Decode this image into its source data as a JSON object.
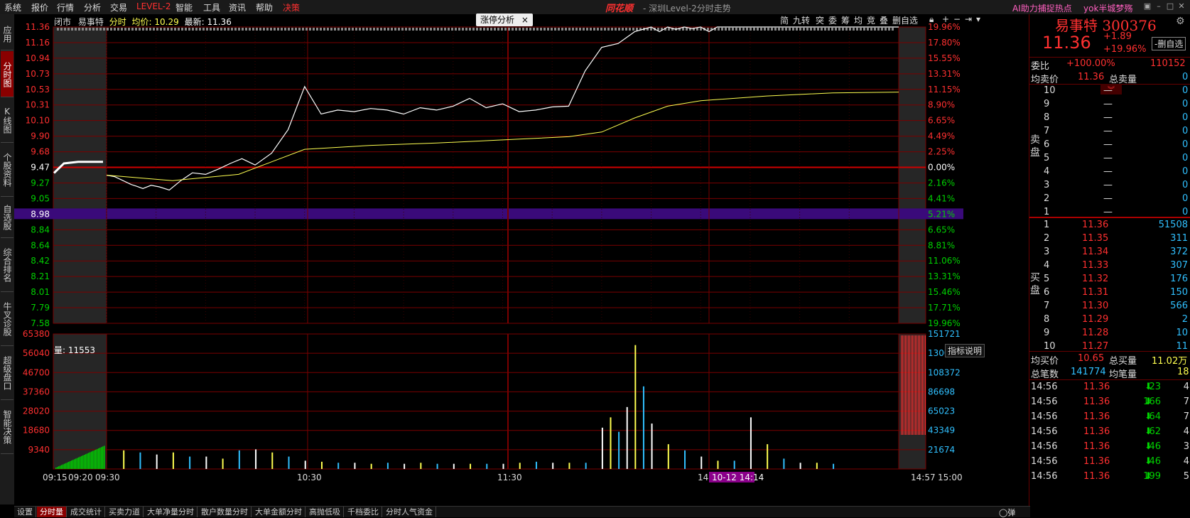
{
  "menu": {
    "items": [
      "系统",
      "报价",
      "行情",
      "分析",
      "交易",
      "LEVEL-2",
      "智能",
      "工具",
      "资讯",
      "帮助",
      "决策"
    ]
  },
  "window": {
    "brand": "同花顺",
    "title": "- 深圳Level-2分时走势",
    "ai_link": "AI助力捕捉热点",
    "user": "yok半城梦殇"
  },
  "sidebar": {
    "tabs": [
      "应用",
      "分时图",
      "K线图",
      "个股资料",
      "自选股",
      "综合排名",
      "牛叉诊股",
      "超级盘口",
      "智能决策"
    ]
  },
  "info": {
    "status": "闭市",
    "name": "易事特",
    "mode": "分时",
    "avg_label": "均价:",
    "avg": "10.29",
    "last_label": "最新:",
    "last": "11.36"
  },
  "limit_tag": {
    "label": "涨停分析",
    "close": "×"
  },
  "toolbar": {
    "items": [
      "简",
      "九转",
      "突",
      "委",
      "筹",
      "均",
      "竞",
      "叠",
      "删自选"
    ]
  },
  "chart_data": [
    {
      "type": "line",
      "title": "",
      "x_ticks": [
        "09:15",
        "09:20",
        "09:30",
        "10:30",
        "11:30",
        "14:00",
        "14:57",
        "15:00"
      ],
      "cursor_label": "10-12 14:14",
      "price_ticks": [
        "11.36",
        "11.16",
        "10.94",
        "10.73",
        "10.53",
        "10.31",
        "10.10",
        "9.90",
        "9.68",
        "9.47",
        "9.27",
        "9.05",
        "8.98",
        "8.84",
        "8.64",
        "8.42",
        "8.21",
        "8.01",
        "7.79",
        "7.58"
      ],
      "pct_ticks": [
        "19.96%",
        "17.80%",
        "15.55%",
        "13.31%",
        "11.15%",
        "8.90%",
        "6.65%",
        "4.49%",
        "2.25%",
        "0.00%",
        "2.16%",
        "4.41%",
        "5.21%",
        "6.65%",
        "8.81%",
        "11.06%",
        "13.31%",
        "15.46%",
        "17.71%",
        "19.96%"
      ],
      "ylim": [
        7.58,
        11.36
      ],
      "prev_close": 9.47,
      "highlight_price": "8.98",
      "highlight_pct": "5.21%",
      "series": [
        {
          "name": "",
          "x": [
            0,
            5,
            10,
            15,
            18,
            22,
            27,
            32,
            38,
            45,
            52,
            60,
            68,
            75,
            82,
            90,
            100,
            110,
            120,
            130,
            140,
            150,
            160,
            170,
            180,
            190,
            200,
            210,
            220,
            230,
            240,
            250,
            260,
            270,
            280,
            290,
            300,
            310,
            320,
            330,
            335,
            340,
            345,
            350,
            355,
            360,
            365,
            370,
            375,
            380,
            385,
            390,
            395,
            400,
            410,
            420,
            430,
            440,
            450,
            460,
            470,
            480
          ],
          "y": [
            9.47,
            9.45,
            9.4,
            9.35,
            9.33,
            9.3,
            9.34,
            9.32,
            9.28,
            9.4,
            9.5,
            9.48,
            9.55,
            9.62,
            9.68,
            9.6,
            9.75,
            10.05,
            10.6,
            10.25,
            10.3,
            10.28,
            10.32,
            10.3,
            10.25,
            10.33,
            10.3,
            10.35,
            10.45,
            10.33,
            10.38,
            10.28,
            10.3,
            10.34,
            10.35,
            10.8,
            11.1,
            11.15,
            11.3,
            11.36,
            11.3,
            11.36,
            11.33,
            11.36,
            11.34,
            11.36,
            11.3,
            11.36,
            11.36,
            11.36,
            11.36,
            11.36,
            11.36,
            11.36,
            11.36,
            11.36,
            11.36,
            11.36,
            11.36,
            11.36,
            11.36,
            11.36
          ]
        },
        {
          "name": "",
          "x": [
            0,
            40,
            80,
            120,
            160,
            200,
            240,
            280,
            300,
            320,
            340,
            360,
            400,
            440,
            480
          ],
          "y": [
            9.47,
            9.4,
            9.48,
            9.8,
            9.85,
            9.88,
            9.92,
            9.96,
            10.02,
            10.2,
            10.35,
            10.42,
            10.48,
            10.52,
            10.53
          ]
        }
      ]
    },
    {
      "type": "bar",
      "title": "",
      "label": "量: 11553",
      "indicator_button": "指标说明",
      "left_ticks": [
        "65380",
        "56040",
        "46700",
        "37360",
        "28020",
        "18680",
        "9340"
      ],
      "right_ticks": [
        "151721",
        "130047",
        "108372",
        "86698",
        "65023",
        "43349",
        "21674"
      ],
      "ylim": [
        0,
        65380
      ],
      "x": [
        10,
        20,
        30,
        40,
        50,
        60,
        70,
        80,
        90,
        100,
        110,
        120,
        130,
        140,
        150,
        160,
        170,
        180,
        190,
        200,
        210,
        220,
        230,
        240,
        250,
        260,
        270,
        280,
        290,
        300,
        305,
        310,
        315,
        320,
        325,
        330,
        340,
        350,
        360,
        370,
        380,
        390,
        400,
        410,
        420,
        430,
        440
      ],
      "values": [
        9000,
        8000,
        7000,
        8000,
        6000,
        6000,
        5000,
        9000,
        9500,
        8000,
        6000,
        4000,
        3500,
        3000,
        3000,
        2500,
        3000,
        2500,
        3000,
        2500,
        2500,
        2500,
        2500,
        2500,
        3000,
        3500,
        3000,
        3000,
        3000,
        20000,
        25000,
        18000,
        30000,
        60000,
        40000,
        22000,
        12000,
        9000,
        6000,
        4000,
        4000,
        25000,
        12000,
        5000,
        3000,
        3000,
        2500
      ]
    }
  ],
  "right": {
    "name": "易事特",
    "code": "300376",
    "price": "11.36",
    "change": "+1.89",
    "pct": "+19.96%",
    "del_btn": "-删自选",
    "weibi_label": "委比",
    "weibi": "+100.00%",
    "weicha": "110152",
    "avg_sell_label": "均卖价",
    "avg_sell": "11.36",
    "total_sell_label": "总卖量",
    "total_sell": "0",
    "sell_label": "卖盘",
    "buy_label": "买盘",
    "sell": [
      {
        "lvl": "10",
        "p": "—",
        "v": "0"
      },
      {
        "lvl": "9",
        "p": "—",
        "v": "0"
      },
      {
        "lvl": "8",
        "p": "—",
        "v": "0"
      },
      {
        "lvl": "7",
        "p": "—",
        "v": "0"
      },
      {
        "lvl": "6",
        "p": "—",
        "v": "0"
      },
      {
        "lvl": "5",
        "p": "—",
        "v": "0"
      },
      {
        "lvl": "4",
        "p": "—",
        "v": "0"
      },
      {
        "lvl": "3",
        "p": "—",
        "v": "0"
      },
      {
        "lvl": "2",
        "p": "—",
        "v": "0"
      },
      {
        "lvl": "1",
        "p": "—",
        "v": "0"
      }
    ],
    "buy": [
      {
        "lvl": "1",
        "p": "11.36",
        "v": "51508"
      },
      {
        "lvl": "2",
        "p": "11.35",
        "v": "311"
      },
      {
        "lvl": "3",
        "p": "11.34",
        "v": "372"
      },
      {
        "lvl": "4",
        "p": "11.33",
        "v": "307"
      },
      {
        "lvl": "5",
        "p": "11.32",
        "v": "176"
      },
      {
        "lvl": "6",
        "p": "11.31",
        "v": "150"
      },
      {
        "lvl": "7",
        "p": "11.30",
        "v": "566"
      },
      {
        "lvl": "8",
        "p": "11.29",
        "v": "2"
      },
      {
        "lvl": "9",
        "p": "11.28",
        "v": "10"
      },
      {
        "lvl": "10",
        "p": "11.27",
        "v": "11"
      }
    ],
    "avg_buy_label": "均买价",
    "avg_buy": "10.65",
    "total_buy_label": "总买量",
    "total_buy": "11.02万",
    "total_trades_label": "总笔数",
    "total_trades": "141774",
    "avg_trade_label": "均笔量",
    "avg_trade": "18",
    "ticks": [
      {
        "t": "14:56",
        "p": "11.36",
        "v": "23",
        "n": "4"
      },
      {
        "t": "14:56",
        "p": "11.36",
        "v": "166",
        "n": "7"
      },
      {
        "t": "14:56",
        "p": "11.36",
        "v": "64",
        "n": "7"
      },
      {
        "t": "14:56",
        "p": "11.36",
        "v": "62",
        "n": "4"
      },
      {
        "t": "14:56",
        "p": "11.36",
        "v": "46",
        "n": "3"
      },
      {
        "t": "14:56",
        "p": "11.36",
        "v": "46",
        "n": "4"
      },
      {
        "t": "14:56",
        "p": "11.36",
        "v": "199",
        "n": "5"
      }
    ]
  },
  "bottom_tabs": [
    "设置",
    "分时量",
    "成交统计",
    "买卖力道",
    "大单净量分时",
    "散户数量分时",
    "大单金额分时",
    "高抛低吸",
    "千档委比",
    "分时人气资金"
  ],
  "colors": {
    "red": "#ff3030",
    "green": "#00d000",
    "yellow": "#ffff50",
    "grid": "#7a0000",
    "white": "#ffffff"
  }
}
